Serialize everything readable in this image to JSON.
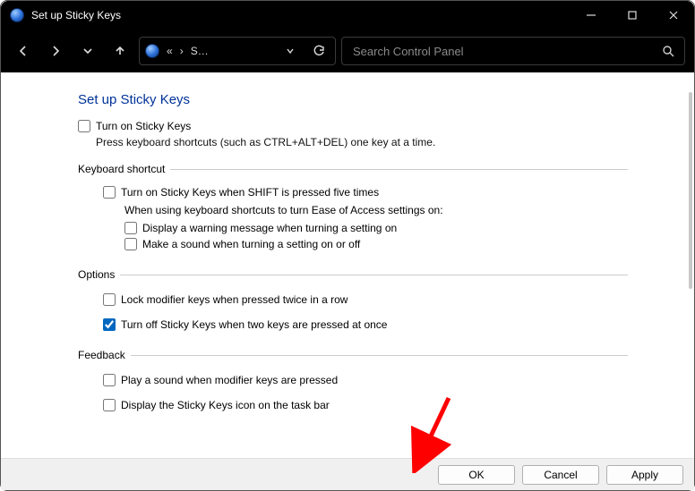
{
  "window": {
    "title": "Set up Sticky Keys"
  },
  "addressbar": {
    "crumb_sep1": "«",
    "crumb_sep2": "›",
    "crumb_text": "S…"
  },
  "search": {
    "placeholder": "Search Control Panel"
  },
  "page": {
    "title": "Set up Sticky Keys",
    "turn_on_label": "Turn on Sticky Keys",
    "turn_on_desc": "Press keyboard shortcuts (such as CTRL+ALT+DEL) one key at a time."
  },
  "groups": {
    "keyboard_shortcut": {
      "legend": "Keyboard shortcut",
      "shift5_label": "Turn on Sticky Keys when SHIFT is pressed five times",
      "subtext": "When using keyboard shortcuts to turn Ease of Access settings on:",
      "warn_label": "Display a warning message when turning a setting on",
      "sound_label": "Make a sound when turning a setting on or off"
    },
    "options": {
      "legend": "Options",
      "lock_label": "Lock modifier keys when pressed twice in a row",
      "twokeys_label": "Turn off Sticky Keys when two keys are pressed at once"
    },
    "feedback": {
      "legend": "Feedback",
      "playsound_label": "Play a sound when modifier keys are pressed",
      "taskbar_label": "Display the Sticky Keys icon on the task bar"
    }
  },
  "checked": {
    "turn_on": false,
    "shift5": false,
    "warn": false,
    "sound": false,
    "lock": false,
    "twokeys": true,
    "playsound": false,
    "taskbar": false
  },
  "buttons": {
    "ok": "OK",
    "cancel": "Cancel",
    "apply": "Apply"
  }
}
